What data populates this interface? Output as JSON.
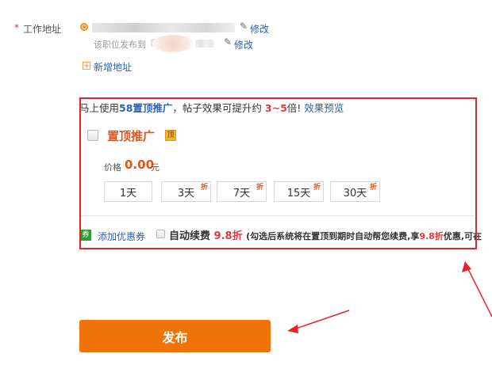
{
  "address": {
    "label": "工作地址",
    "required_mark": "*",
    "edit_label_1": "修改",
    "note": "该职位发布到",
    "edit_label_2": "修改",
    "add_label": "新增地址"
  },
  "promo": {
    "prefix": "马上使用",
    "product": "58置顶推广",
    "middle": "，帖子效果可提升约 ",
    "multiplier": "3~5",
    "suffix": "倍! ",
    "preview_link": "效果预览",
    "title": "置顶推广",
    "badge": "顶",
    "price_label": "价格",
    "price_value": "0.00",
    "price_unit": "元",
    "durations": [
      {
        "label": "1天",
        "discount": ""
      },
      {
        "label": "3天",
        "discount": "折"
      },
      {
        "label": "7天",
        "discount": "折"
      },
      {
        "label": "15天",
        "discount": "折"
      },
      {
        "label": "30天",
        "discount": "折"
      }
    ],
    "coupon_icon": "券",
    "coupon_link": "添加优惠券",
    "auto_renew": {
      "label": "自动续费",
      "discount": "9.8折",
      "desc_prefix": "(勾选后系统将在置顶到期时自动帮您续费,享",
      "desc_discount": "9.8折",
      "desc_suffix": "优惠,可在"
    }
  },
  "publish_label": "发布",
  "colors": {
    "accent_orange": "#f0730a",
    "annotation_red": "#e8222a",
    "link_blue": "#2a62b8",
    "price_orange": "#e4541a"
  }
}
